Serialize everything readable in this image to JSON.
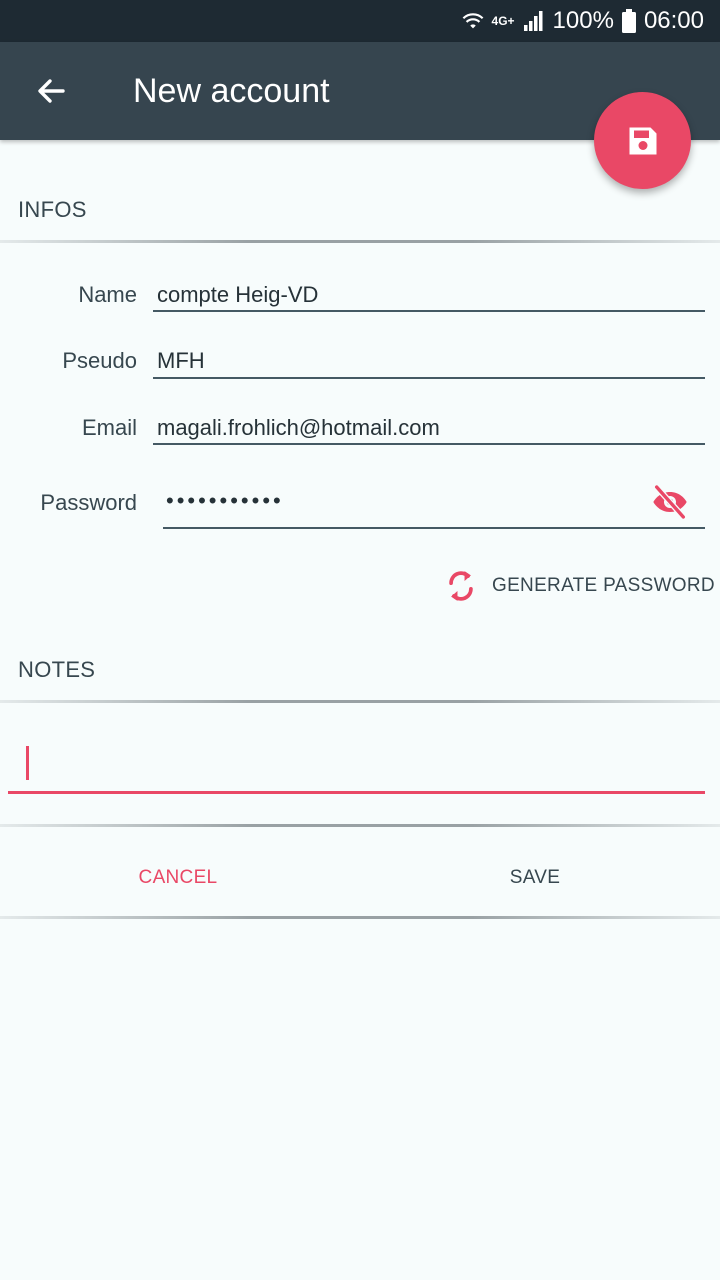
{
  "status_bar": {
    "network": "4G+",
    "battery": "100%",
    "time": "06:00"
  },
  "app_bar": {
    "title": "New account"
  },
  "sections": {
    "infos": "INFOS",
    "notes": "NOTES"
  },
  "fields": {
    "name": {
      "label": "Name",
      "value": "compte Heig-VD"
    },
    "pseudo": {
      "label": "Pseudo",
      "value": "MFH"
    },
    "email": {
      "label": "Email",
      "value": "magali.frohlich@hotmail.com"
    },
    "password": {
      "label": "Password",
      "value": "•••••••••••"
    }
  },
  "generate_password_label": "GENERATE PASSWORD",
  "notes_value": "",
  "actions": {
    "cancel": "CANCEL",
    "save": "SAVE"
  },
  "colors": {
    "accent": "#e94866",
    "app_bar": "#36454f",
    "status_bar": "#1e2a33",
    "background": "#f7fcfc"
  }
}
